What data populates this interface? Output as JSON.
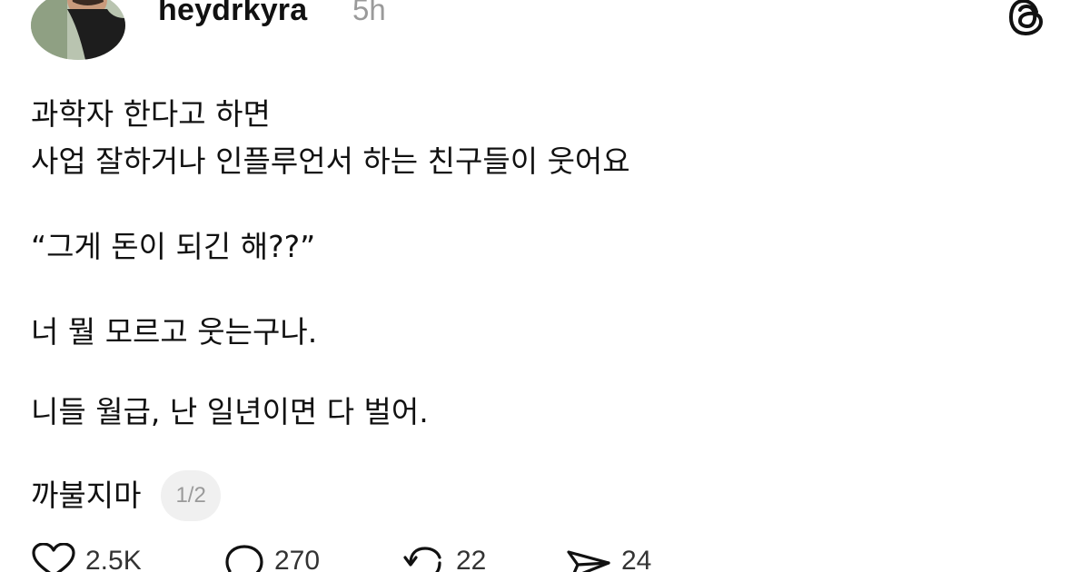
{
  "post": {
    "username": "heydrkyra",
    "timestamp": "5h",
    "lines": {
      "line1": "과학자 한다고 하면",
      "line2": "사업 잘하거나 인플루언서 하는 친구들이 웃어요",
      "line3": "“그게 돈이 되긴 해??”",
      "line4": "너 뭘 모르고 웃는구나.",
      "line5": "니들 월급, 난 일년이면 다 벌어.",
      "line6": "까불지마"
    },
    "page_indicator": "1/2"
  },
  "actions": {
    "likes": "2.5K",
    "comments": "270",
    "reposts": "22",
    "shares": "24"
  },
  "icons": {
    "logo": "threads-logo-icon",
    "like": "heart-icon",
    "comment": "comment-bubble-icon",
    "repost": "repost-icon",
    "share": "send-icon"
  }
}
